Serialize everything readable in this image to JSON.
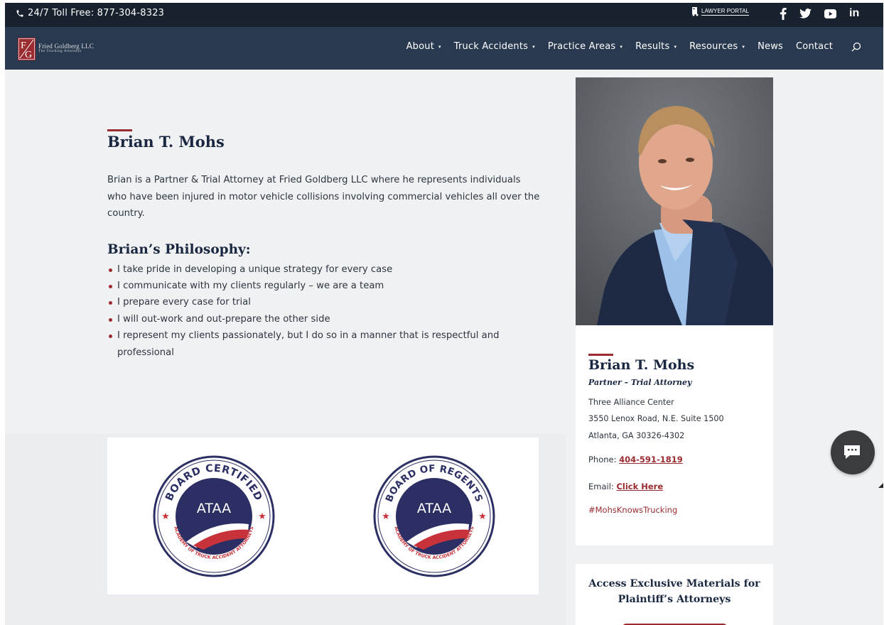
{
  "topbar": {
    "phone": "24/7 Toll Free: 877-304-8323",
    "portal_label": "LAWYER PORTAL",
    "socials": [
      "facebook-icon",
      "twitter-icon",
      "youtube-icon",
      "linkedin-icon"
    ],
    "linkedin_text": "in"
  },
  "logo": {
    "line1": "Fried Goldberg LLC",
    "line2": "The Trucking Attorneys"
  },
  "nav": {
    "items": [
      {
        "label": "About",
        "caret": "▾"
      },
      {
        "label": "Truck Accidents",
        "caret": "▾"
      },
      {
        "label": "Practice Areas",
        "caret": "▾"
      },
      {
        "label": "Results",
        "caret": "▾"
      },
      {
        "label": "Resources",
        "caret": "▾"
      },
      {
        "label": "News"
      },
      {
        "label": "Contact"
      }
    ]
  },
  "main": {
    "name": "Brian T. Mohs",
    "bio": "Brian is a Partner & Trial Attorney at Fried Goldberg LLC where he represents individuals who have been injured in motor vehicle collisions involving commercial vehicles all over the country.",
    "philosophy_heading": "Brian’s Philosophy:",
    "philosophy": [
      "I take pride in developing a unique strategy for every case",
      "I communicate with my clients regularly – we are a team",
      "I prepare every case for trial",
      "I will out-work and out-prepare the other side",
      "I represent my clients passionately, but I do so in a manner that is respectful and professional"
    ]
  },
  "badges": [
    {
      "arc": "BOARD CERTIFIED",
      "center": "ATAA",
      "bottom": "ACADEMY OF TRUCK ACCIDENT ATTORNEYS"
    },
    {
      "arc": "BOARD OF REGENTS",
      "center": "ATAA",
      "bottom": "ACADEMY OF TRUCK ACCIDENT ATTORNEYS"
    }
  ],
  "card": {
    "name": "Brian T. Mohs",
    "role": "Partner – Trial Attorney",
    "address": [
      "Three Alliance Center",
      "3550 Lenox Road, N.E. Suite 1500",
      "Atlanta, GA 30326-4302"
    ],
    "phone_label": "Phone: ",
    "phone": "404-591-1819",
    "email_label": "Email: ",
    "email_link": "Click Here",
    "hashtag": "#MohsKnowsTrucking"
  },
  "access": {
    "title": "Access Exclusive Materials for Plaintiff’s Attorneys"
  },
  "colors": {
    "navy": "#293a50",
    "dark": "#18222f",
    "accent": "#9a2b30",
    "badge_navy": "#2c2f63",
    "badge_red": "#c8323a"
  }
}
